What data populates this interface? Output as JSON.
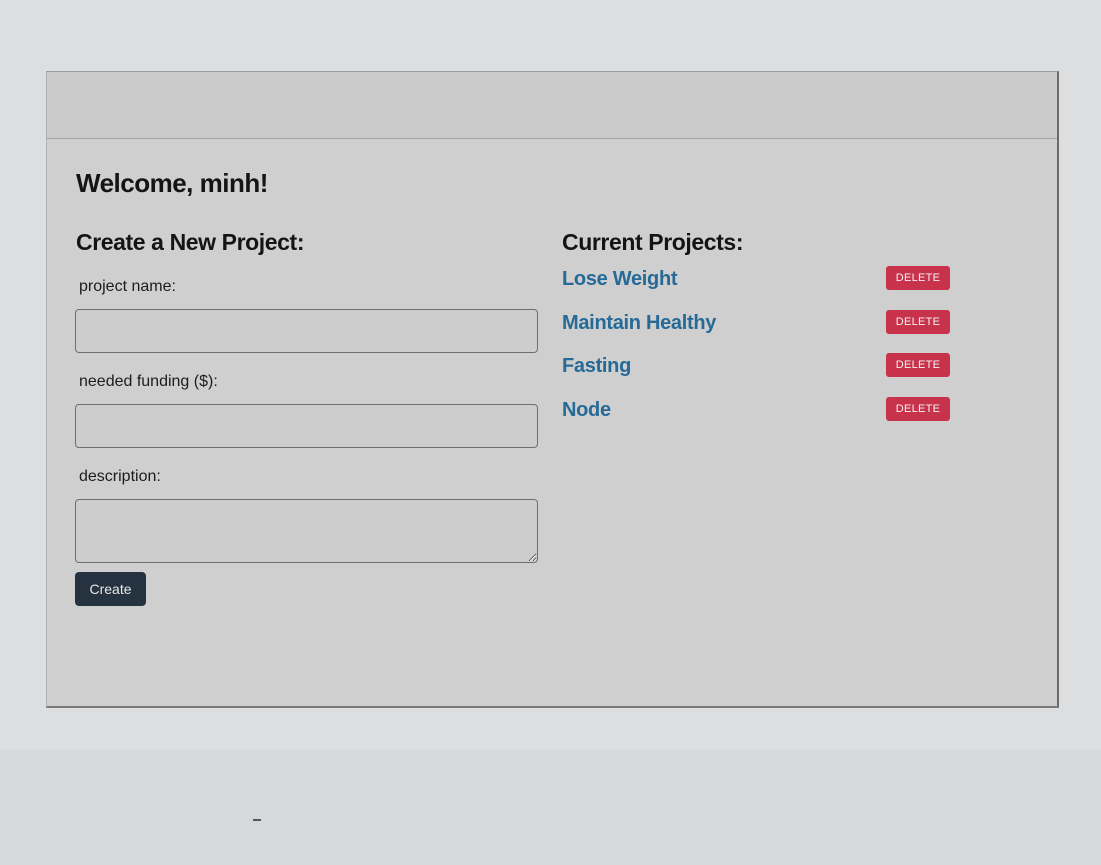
{
  "welcome": "Welcome, minh!",
  "create_form": {
    "title": "Create a New Project:",
    "name_label": "project name:",
    "name_value": "",
    "funding_label": "needed funding ($):",
    "funding_value": "",
    "description_label": "description:",
    "description_value": "",
    "submit_label": "Create"
  },
  "projects": {
    "title": "Current Projects:",
    "delete_label": "DELETE",
    "items": [
      {
        "name": "Lose Weight"
      },
      {
        "name": "Maintain Healthy"
      },
      {
        "name": "Fasting"
      },
      {
        "name": "Node"
      }
    ]
  },
  "colors": {
    "page_background": "#cfcfcf",
    "link": "#266a97",
    "create_button": "#25323f",
    "delete_button": "#c8334b"
  }
}
